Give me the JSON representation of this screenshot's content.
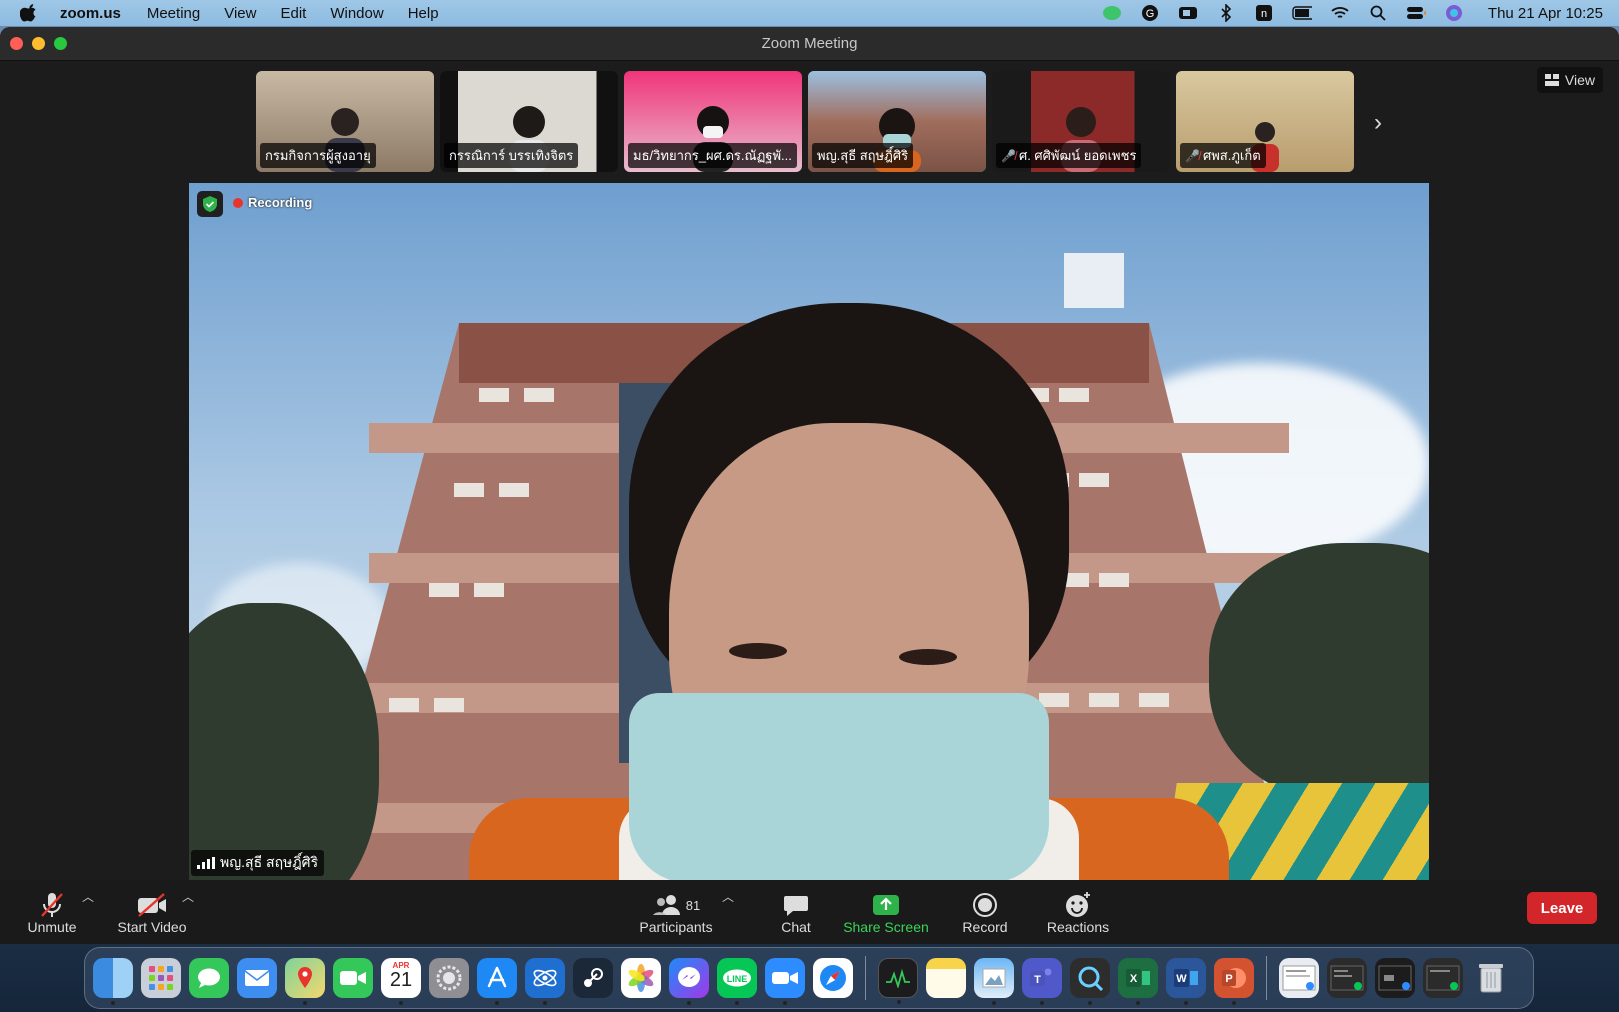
{
  "menubar": {
    "app_name": "zoom.us",
    "menus": [
      "Meeting",
      "View",
      "Edit",
      "Window",
      "Help"
    ],
    "clock": "Thu 21 Apr  10:25"
  },
  "window": {
    "title": "Zoom Meeting"
  },
  "thumbnails": [
    {
      "name": "กรมกิจการผู้สูงอายุ",
      "muted": false,
      "active": false,
      "bg": "#b9a892"
    },
    {
      "name": "กรรณิการ์ บรรเทิงจิตร",
      "muted": false,
      "active": false,
      "bg": "#d9d6d0"
    },
    {
      "name": "มธ/วิทยากร_ผศ.ดร.ณัฏฐพั...",
      "muted": false,
      "active": false,
      "bg": "#f0357a"
    },
    {
      "name": "พญ.สุธี สฤษฎิ์ศิริ",
      "muted": false,
      "active": true,
      "bg": "#8aa7c4"
    },
    {
      "name": "ศ. ศศิพัฒน์ ยอดเพชร",
      "muted": true,
      "active": false,
      "bg": "#7a2a2a"
    },
    {
      "name": "ศพส.ภูเก็ต",
      "muted": true,
      "active": false,
      "bg": "#d6c69a"
    }
  ],
  "view_button": "View",
  "main_video": {
    "recording_label": "Recording",
    "speaker_name": "พญ.สุธี สฤษฎิ์ศิริ"
  },
  "toolbar": {
    "unmute": "Unmute",
    "start_video": "Start Video",
    "participants": "Participants",
    "participants_count": "81",
    "chat": "Chat",
    "share_screen": "Share Screen",
    "record": "Record",
    "reactions": "Reactions",
    "leave": "Leave"
  },
  "dock": {
    "calendar_month": "APR",
    "calendar_day": "21"
  },
  "colors": {
    "accent_green": "#3ad35a",
    "leave_red": "#d3262b",
    "recording_red": "#e8342c"
  }
}
